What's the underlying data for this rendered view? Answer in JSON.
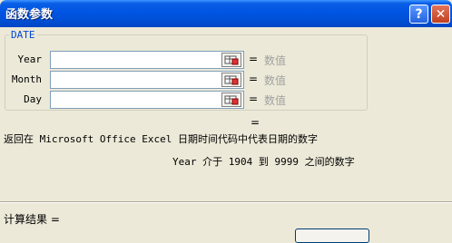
{
  "window": {
    "title": "函数参数",
    "help_glyph": "?",
    "close_glyph": "✕"
  },
  "function_name": "DATE",
  "args": [
    {
      "label": "Year",
      "value": "",
      "equals": "=",
      "hint": "数值"
    },
    {
      "label": "Month",
      "value": "",
      "equals": "=",
      "hint": "数值"
    },
    {
      "label": "Day",
      "value": "",
      "equals": "=",
      "hint": "数值"
    }
  ],
  "result_equals": "=",
  "description": "返回在 Microsoft Office Excel 日期时间代码中代表日期的数字",
  "param_description": "Year  介于 1904 到 9999 之间的数字",
  "calc_result_label": "计算结果 =",
  "colors": {
    "title_bar": "#0054e3",
    "dialog_bg": "#ece9d8",
    "group_label": "#0046d5",
    "hint_text": "#a0a0a0"
  }
}
